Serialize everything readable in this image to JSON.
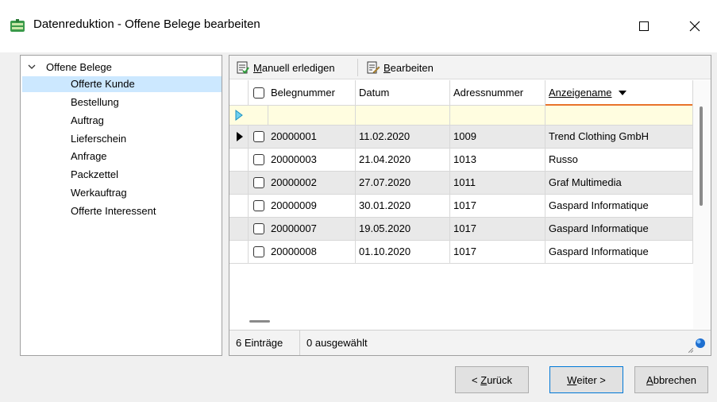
{
  "window": {
    "title": "Datenreduktion - Offene Belege bearbeiten"
  },
  "tree": {
    "root_label": "Offene Belege",
    "items": [
      {
        "label": "Offerte Kunde",
        "selected": true
      },
      {
        "label": "Bestellung"
      },
      {
        "label": "Auftrag"
      },
      {
        "label": "Lieferschein"
      },
      {
        "label": "Anfrage"
      },
      {
        "label": "Packzettel"
      },
      {
        "label": "Werkauftrag"
      },
      {
        "label": "Offerte Interessent"
      }
    ]
  },
  "toolbar": {
    "manual_first": "M",
    "manual_rest": "anuell erledigen",
    "edit_first": "B",
    "edit_rest": "earbeiten"
  },
  "table": {
    "columns": [
      "Belegnummer",
      "Datum",
      "Adressnummer",
      "Anzeigename"
    ],
    "rows": [
      {
        "beleg": "20000001",
        "datum": "11.02.2020",
        "adresse": "1009",
        "name": "Trend Clothing GmbH",
        "current": true
      },
      {
        "beleg": "20000003",
        "datum": "21.04.2020",
        "adresse": "1013",
        "name": "Russo"
      },
      {
        "beleg": "20000002",
        "datum": "27.07.2020",
        "adresse": "1011",
        "name": "Graf Multimedia"
      },
      {
        "beleg": "20000009",
        "datum": "30.01.2020",
        "adresse": "1017",
        "name": "Gaspard Informatique"
      },
      {
        "beleg": "20000007",
        "datum": "19.05.2020",
        "adresse": "1017",
        "name": "Gaspard Informatique"
      },
      {
        "beleg": "20000008",
        "datum": "01.10.2020",
        "adresse": "1017",
        "name": "Gaspard Informatique"
      }
    ]
  },
  "status": {
    "entries": "6 Einträge",
    "selected": "0 ausgewählt"
  },
  "buttons": {
    "back_prefix": "< ",
    "back_mn": "Z",
    "back_rest": "urück",
    "next_mn": "W",
    "next_rest": "eiter >",
    "cancel_mn": "A",
    "cancel_rest": "bbrechen"
  },
  "colors": {
    "selection": "#cce8ff",
    "sort_indicator": "#e8732b",
    "filter_row": "#fffde0",
    "alt_row": "#e9e9e9"
  }
}
